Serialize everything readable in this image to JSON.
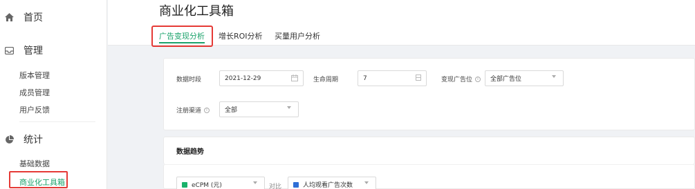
{
  "sidebar": {
    "nav": [
      {
        "label": "首页",
        "icon": "home-icon"
      },
      {
        "label": "管理",
        "icon": "inbox-icon"
      },
      {
        "label": "统计",
        "icon": "pie-chart-icon"
      }
    ],
    "manage_items": [
      "版本管理",
      "成员管理",
      "用户反馈"
    ],
    "stats_items": [
      "基础数据",
      "商业化工具箱"
    ]
  },
  "header": {
    "title": "商业化工具箱",
    "tabs": [
      "广告变现分析",
      "增长ROI分析",
      "买量用户分析"
    ]
  },
  "filters": {
    "data_period_label": "数据时段",
    "data_period_value": "2021-12-29",
    "lifecycle_label": "生命周期",
    "lifecycle_value": "7",
    "ad_slot_label": "变现广告位",
    "ad_slot_value": "全部广告位",
    "channel_label": "注册渠道",
    "channel_value": "全部"
  },
  "trend": {
    "title": "数据趋势",
    "metric1": "eCPM (元)",
    "metric1_color": "#1ab26b",
    "compare_label": "对比",
    "metric2": "人均观看广告次数",
    "metric2_color": "#2f6fd6"
  },
  "colors": {
    "accent": "#1aa26a",
    "highlight": "#e53935"
  }
}
